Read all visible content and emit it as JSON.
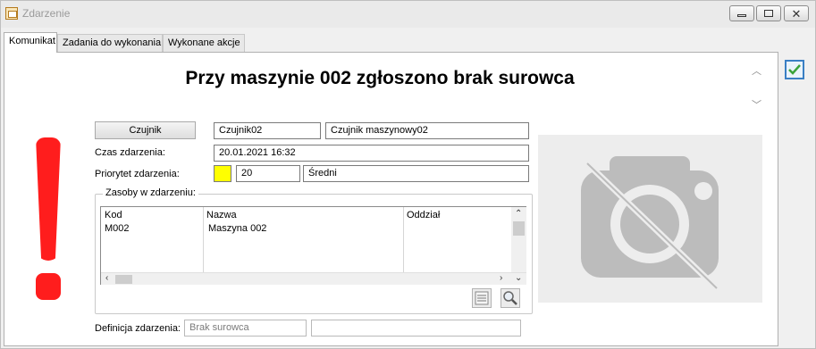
{
  "window": {
    "title": "Zdarzenie"
  },
  "tabs": [
    {
      "label": "Komunikat",
      "active": true
    },
    {
      "label": "Zadania do wykonania",
      "active": false
    },
    {
      "label": "Wykonane akcje",
      "active": false
    }
  ],
  "event": {
    "headline": "Przy maszynie 002 zgłoszono brak surowca",
    "sensor_button": "Czujnik",
    "sensor_code": "Czujnik02",
    "sensor_name": "Czujnik maszynowy02",
    "time_label": "Czas zdarzenia:",
    "time_value": "20.01.2021 16:32",
    "priority_label": "Priorytet zdarzenia:",
    "priority_color": "#ffff00",
    "priority_number": "20",
    "priority_name": "Średni",
    "resources_label": "Zasoby w zdarzeniu:",
    "definition_label": "Definicja zdarzenia:",
    "definition_value": "Brak surowca",
    "definition_extra": ""
  },
  "resources": {
    "columns": [
      "Kod",
      "Nazwa",
      "Oddział"
    ],
    "rows": [
      {
        "kod": "M002",
        "nazwa": "Maszyna 002",
        "oddzial": ""
      }
    ]
  },
  "icons": {
    "alert": "exclamation-icon",
    "photo": "no-photo-camera-icon",
    "confirm": "checkmark-icon",
    "list": "list-details-icon",
    "search": "magnifier-icon"
  },
  "colors": {
    "alert": "#ff1d1d",
    "accent": "#3a7fc4"
  }
}
